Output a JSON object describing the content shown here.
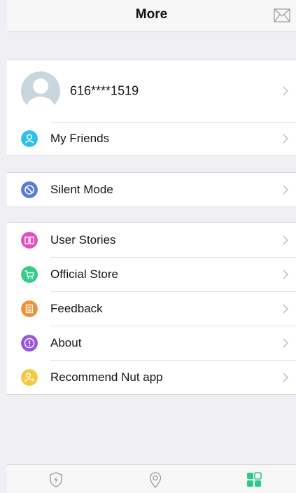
{
  "header": {
    "title": "More",
    "right_icon": "mail-icon"
  },
  "profile": {
    "phone": "616****1519",
    "icon": "avatar-icon"
  },
  "sections": {
    "friends": {
      "label": "My Friends",
      "icon": "person-icon",
      "color": "#2fc0e8"
    },
    "silent": {
      "label": "Silent Mode",
      "icon": "no-entry-icon",
      "color": "#5a7bd8"
    },
    "stories": {
      "label": "User Stories",
      "icon": "book-icon",
      "color": "#e04fc0"
    },
    "store": {
      "label": "Official Store",
      "icon": "cart-icon",
      "color": "#35cc86"
    },
    "feedback": {
      "label": "Feedback",
      "icon": "document-icon",
      "color": "#f0913a"
    },
    "about": {
      "label": "About",
      "icon": "info-icon",
      "color": "#9a55dd"
    },
    "recommend": {
      "label": "Recommend Nut app",
      "icon": "share-person-icon",
      "color": "#f5c842"
    }
  },
  "tabbar": {
    "tabs": [
      {
        "name": "shield-bolt-icon",
        "active": false
      },
      {
        "name": "location-pin-icon",
        "active": false
      },
      {
        "name": "grid-icon",
        "active": true
      }
    ],
    "active_color": "#2ec98a",
    "inactive_color": "#9a9a9a"
  }
}
